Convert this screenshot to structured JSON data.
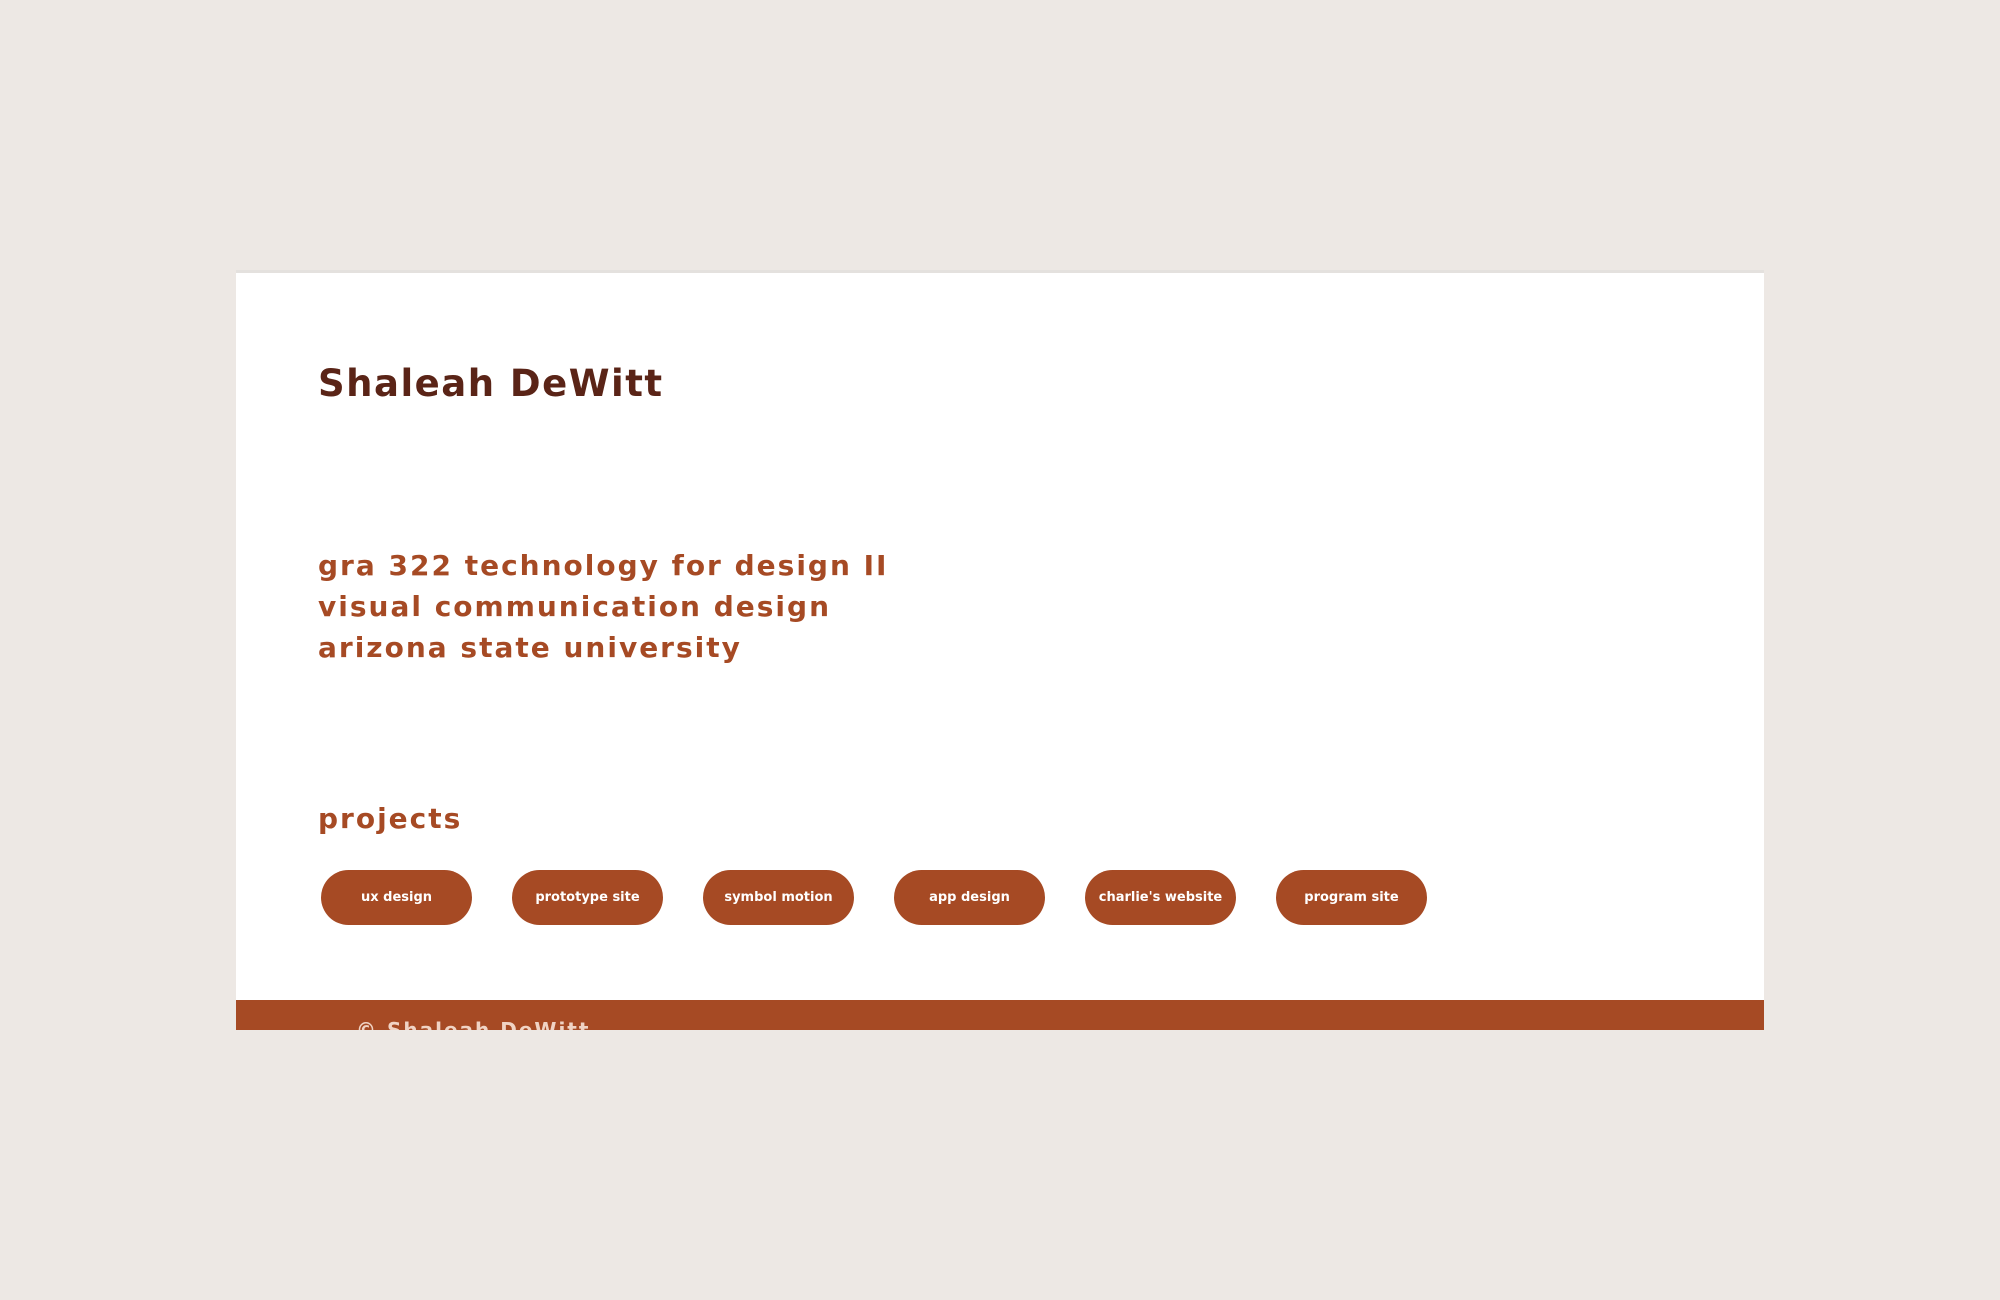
{
  "header": {
    "title": "Shaleah DeWitt"
  },
  "course": {
    "lines": [
      "gra 322 technology for design II",
      "visual communication design",
      "arizona state university"
    ]
  },
  "projects": {
    "heading": "projects",
    "buttons": [
      {
        "label": "ux design"
      },
      {
        "label": "prototype site"
      },
      {
        "label": "symbol motion"
      },
      {
        "label": "app design"
      },
      {
        "label": "charlie's website"
      },
      {
        "label": "program site"
      }
    ]
  },
  "footer": {
    "copyright": "© Shaleah DeWitt"
  },
  "colors": {
    "page_background": "#ede8e4",
    "card_background": "#ffffff",
    "title_text": "#5a2417",
    "accent": "#a64a24",
    "button_text": "#ffffff",
    "footer_text": "#f0d3c4"
  }
}
